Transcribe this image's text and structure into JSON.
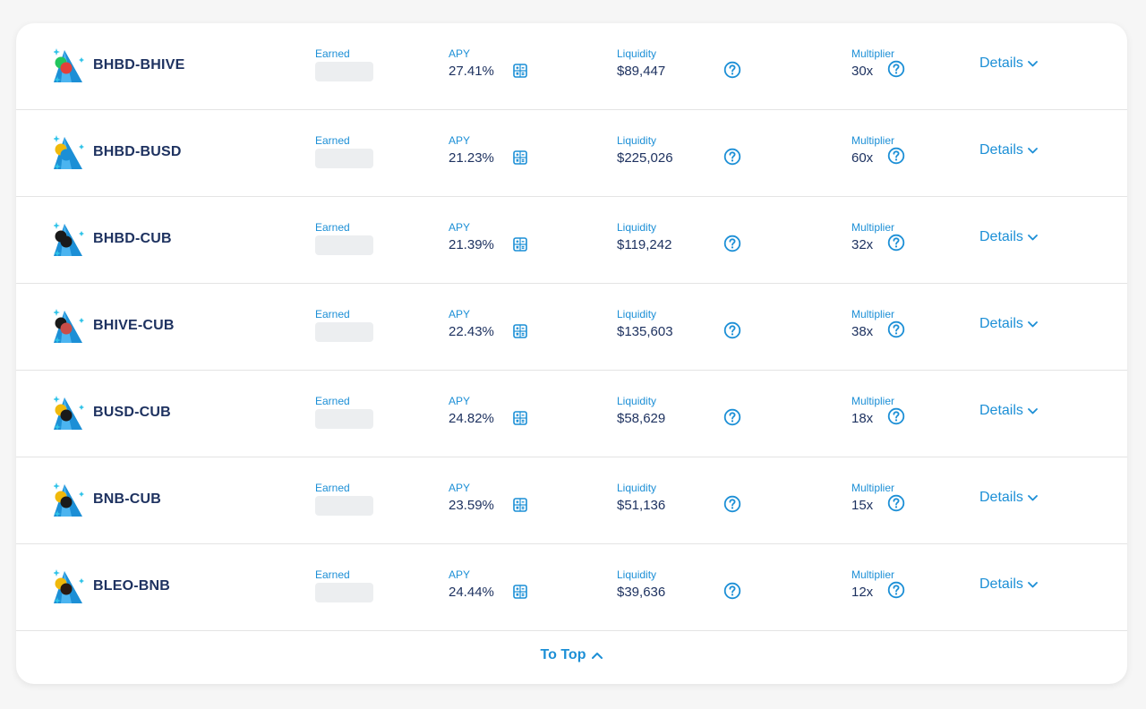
{
  "labels": {
    "earned": "Earned",
    "apy": "APY",
    "liquidity": "Liquidity",
    "multiplier": "Multiplier",
    "details": "Details",
    "to_top": "To Top"
  },
  "colors": {
    "accent": "#1c8fd6",
    "name": "#1e3260",
    "skeleton": "#eceef0"
  },
  "farms": [
    {
      "name": "BHBD-BHIVE",
      "apy": "27.41%",
      "liquidity": "$89,447",
      "multiplier": "30x"
    },
    {
      "name": "BHBD-BUSD",
      "apy": "21.23%",
      "liquidity": "$225,026",
      "multiplier": "60x"
    },
    {
      "name": "BHBD-CUB",
      "apy": "21.39%",
      "liquidity": "$119,242",
      "multiplier": "32x"
    },
    {
      "name": "BHIVE-CUB",
      "apy": "22.43%",
      "liquidity": "$135,603",
      "multiplier": "38x"
    },
    {
      "name": "BUSD-CUB",
      "apy": "24.82%",
      "liquidity": "$58,629",
      "multiplier": "18x"
    },
    {
      "name": "BNB-CUB",
      "apy": "23.59%",
      "liquidity": "$51,136",
      "multiplier": "15x"
    },
    {
      "name": "BLEO-BNB",
      "apy": "24.44%",
      "liquidity": "$39,636",
      "multiplier": "12x"
    }
  ]
}
